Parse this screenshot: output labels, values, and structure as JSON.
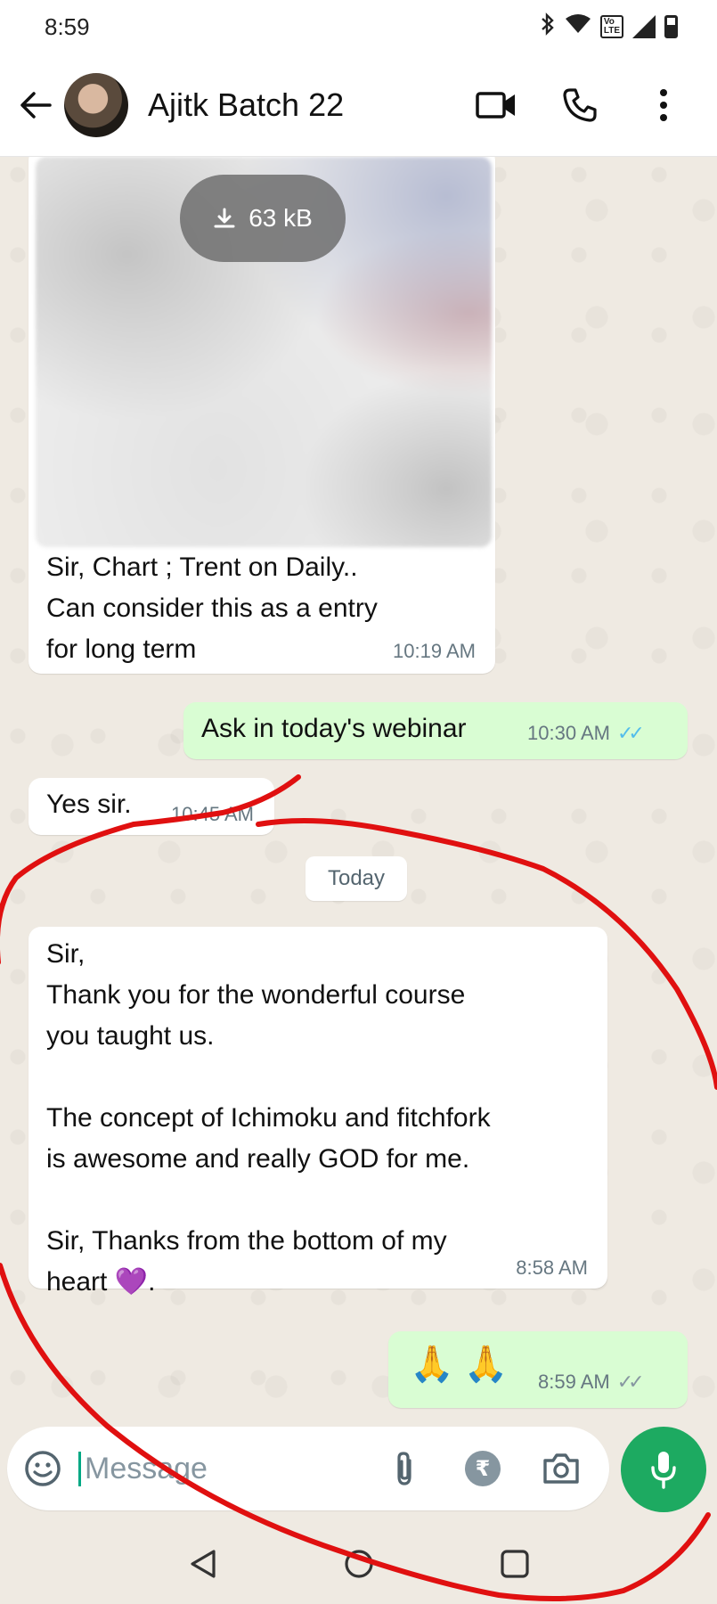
{
  "status_bar": {
    "time": "8:59",
    "lte_label": "Vo\nLTE"
  },
  "header": {
    "chat_name": "Ajitk Batch 22"
  },
  "messages": {
    "image_message": {
      "download_size": "63 kB",
      "caption": "Sir, Chart ; Trent on Daily..\nCan consider this as a entry\nfor long term",
      "time": "10:19 AM"
    },
    "reply_webinar": {
      "text": "Ask in today's webinar",
      "time": "10:30 AM",
      "status": "read"
    },
    "yes_sir": {
      "text": "Yes sir.",
      "time": "10:45 AM"
    },
    "date_divider": "Today",
    "thank_you": {
      "text": "Sir,\nThank you for the wonderful course\nyou taught us.\n\nThe concept of Ichimoku and fitchfork\nis awesome and really GOD for me.\n\nSir, Thanks from the bottom of my\nheart 💜.",
      "time": "8:58 AM"
    },
    "emoji_reply": {
      "text": "🙏 🙏",
      "time": "8:59 AM",
      "status": "delivered"
    }
  },
  "composer": {
    "placeholder": "Message"
  },
  "colors": {
    "chat_background": "#efeae2",
    "outgoing_bubble": "#d9fdd3",
    "incoming_bubble": "#ffffff",
    "mic_button": "#1daa61",
    "read_ticks": "#53bdeb",
    "annotation_stroke": "#e01010"
  },
  "icons": {
    "header": [
      "back-arrow-icon",
      "video-call-icon",
      "voice-call-icon",
      "more-options-icon"
    ],
    "composer": [
      "emoji-icon",
      "attach-icon",
      "rupee-payment-icon",
      "camera-icon",
      "mic-icon"
    ],
    "nav": [
      "back-triangle-icon",
      "home-circle-icon",
      "recents-square-icon"
    ]
  }
}
